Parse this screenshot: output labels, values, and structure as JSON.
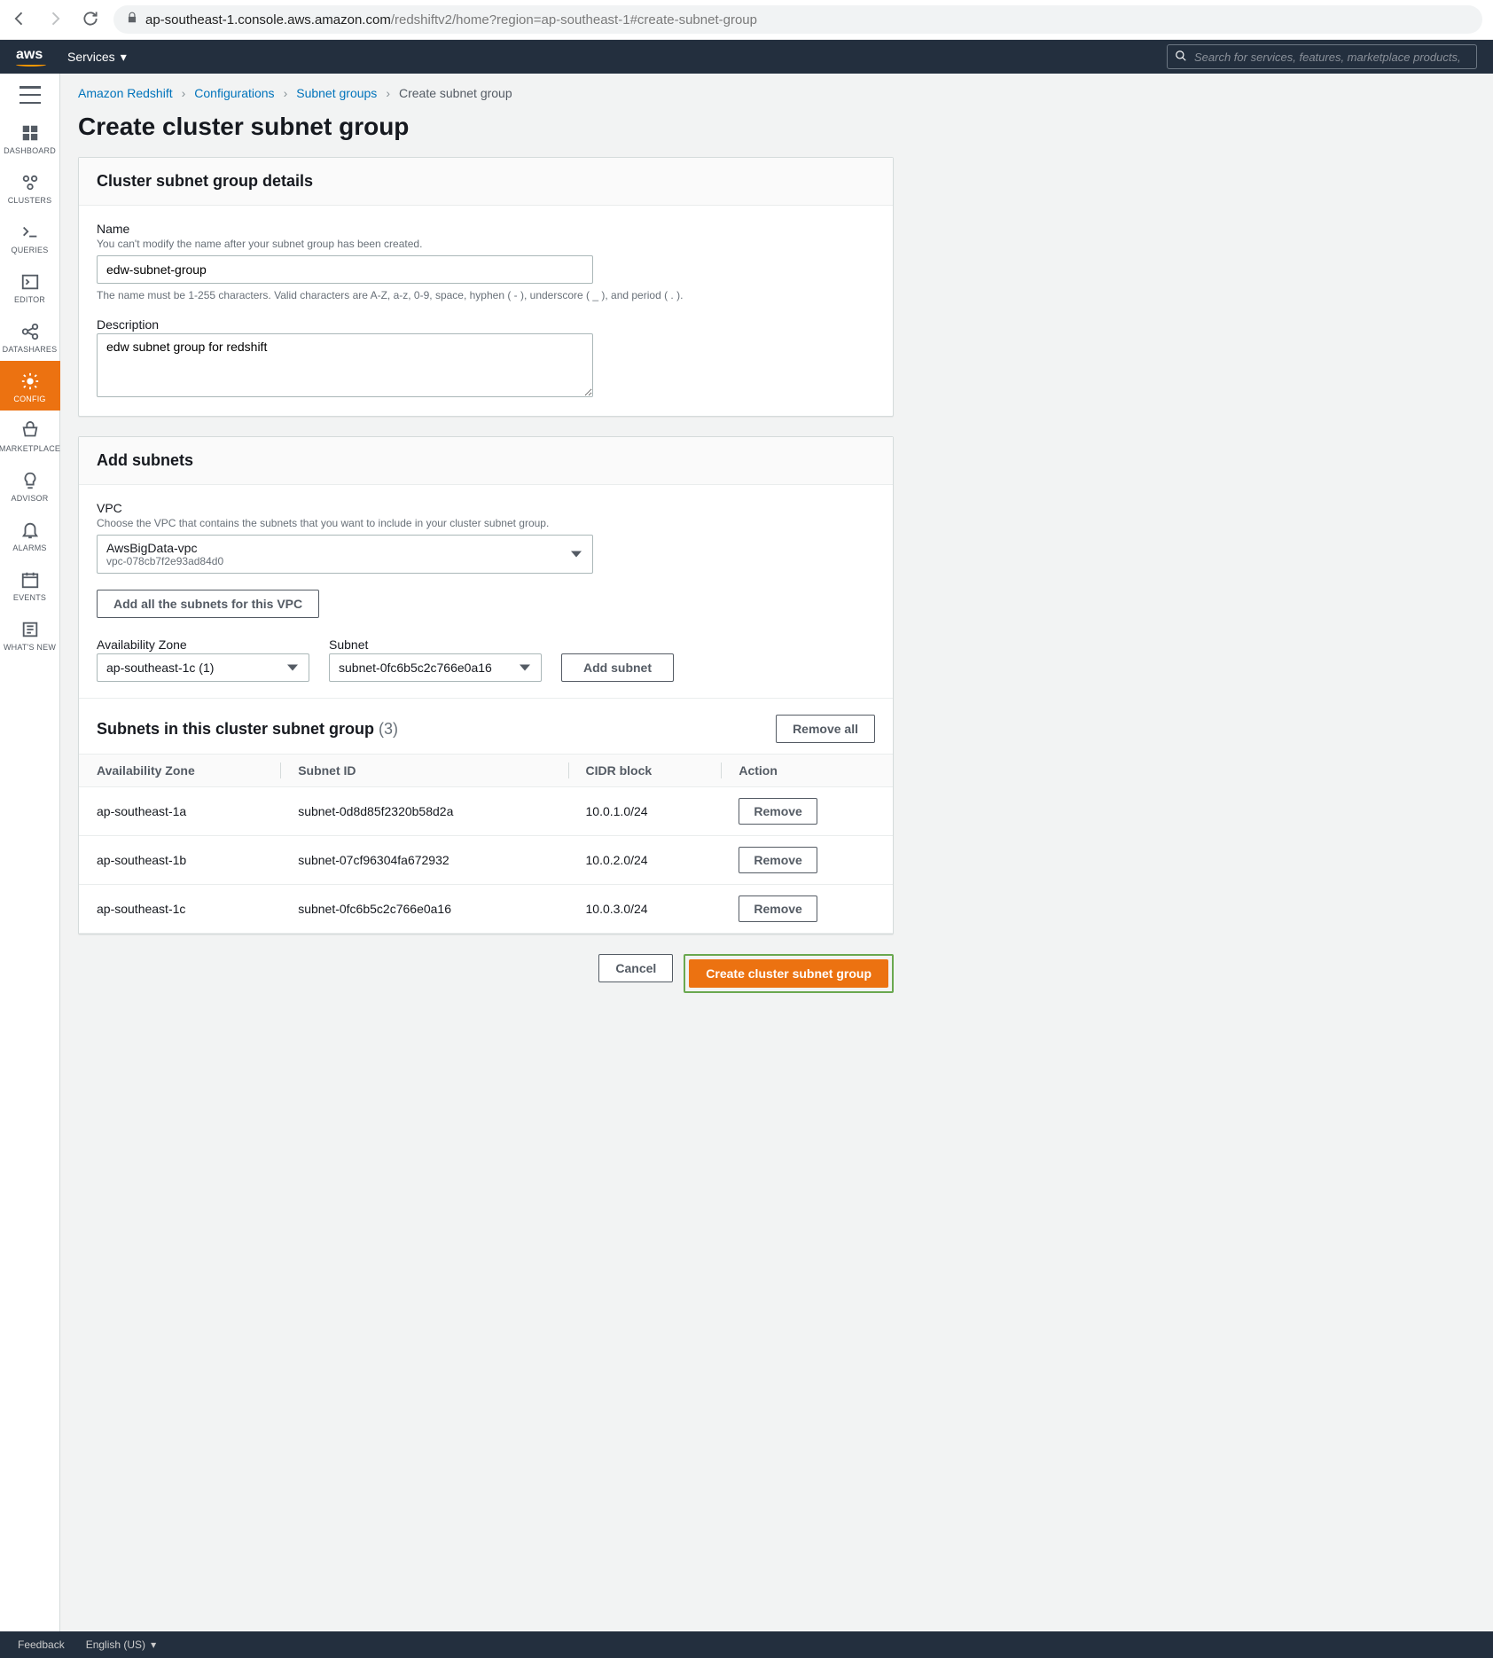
{
  "browser": {
    "url_host": "ap-southeast-1.console.aws.amazon.com",
    "url_path": "/redshiftv2/home?region=ap-southeast-1#create-subnet-group"
  },
  "nav": {
    "services_label": "Services",
    "search_placeholder": "Search for services, features, marketplace products,"
  },
  "rail": {
    "items": [
      {
        "label": "DASHBOARD"
      },
      {
        "label": "CLUSTERS"
      },
      {
        "label": "QUERIES"
      },
      {
        "label": "EDITOR"
      },
      {
        "label": "DATASHARES"
      },
      {
        "label": "CONFIG"
      },
      {
        "label": "MARKETPLACE"
      },
      {
        "label": "ADVISOR"
      },
      {
        "label": "ALARMS"
      },
      {
        "label": "EVENTS"
      },
      {
        "label": "WHAT'S NEW"
      }
    ]
  },
  "breadcrumb": {
    "items": [
      "Amazon Redshift",
      "Configurations",
      "Subnet groups"
    ],
    "current": "Create subnet group"
  },
  "page": {
    "title": "Create cluster subnet group"
  },
  "details": {
    "header": "Cluster subnet group details",
    "name_label": "Name",
    "name_hint": "You can't modify the name after your subnet group has been created.",
    "name_value": "edw-subnet-group",
    "name_help": "The name must be 1-255 characters. Valid characters are A-Z, a-z, 0-9, space, hyphen ( - ), underscore ( _ ), and period ( . ).",
    "desc_label": "Description",
    "desc_value": "edw subnet group for redshift"
  },
  "add_subnets": {
    "header": "Add subnets",
    "vpc_label": "VPC",
    "vpc_hint": "Choose the VPC that contains the subnets that you want to include in your cluster subnet group.",
    "vpc_name": "AwsBigData-vpc",
    "vpc_id": "vpc-078cb7f2e93ad84d0",
    "add_all_label": "Add all the subnets for this VPC",
    "az_label": "Availability Zone",
    "az_value": "ap-southeast-1c (1)",
    "subnet_label": "Subnet",
    "subnet_value": "subnet-0fc6b5c2c766e0a16",
    "add_subnet_label": "Add subnet"
  },
  "subnet_list": {
    "header": "Subnets in this cluster subnet group",
    "count": "(3)",
    "remove_all_label": "Remove all",
    "columns": [
      "Availability Zone",
      "Subnet ID",
      "CIDR block",
      "Action"
    ],
    "rows": [
      {
        "az": "ap-southeast-1a",
        "subnet": "subnet-0d8d85f2320b58d2a",
        "cidr": "10.0.1.0/24",
        "action": "Remove"
      },
      {
        "az": "ap-southeast-1b",
        "subnet": "subnet-07cf96304fa672932",
        "cidr": "10.0.2.0/24",
        "action": "Remove"
      },
      {
        "az": "ap-southeast-1c",
        "subnet": "subnet-0fc6b5c2c766e0a16",
        "cidr": "10.0.3.0/24",
        "action": "Remove"
      }
    ]
  },
  "actions": {
    "cancel": "Cancel",
    "create": "Create cluster subnet group"
  },
  "footer": {
    "feedback": "Feedback",
    "language": "English (US)"
  }
}
